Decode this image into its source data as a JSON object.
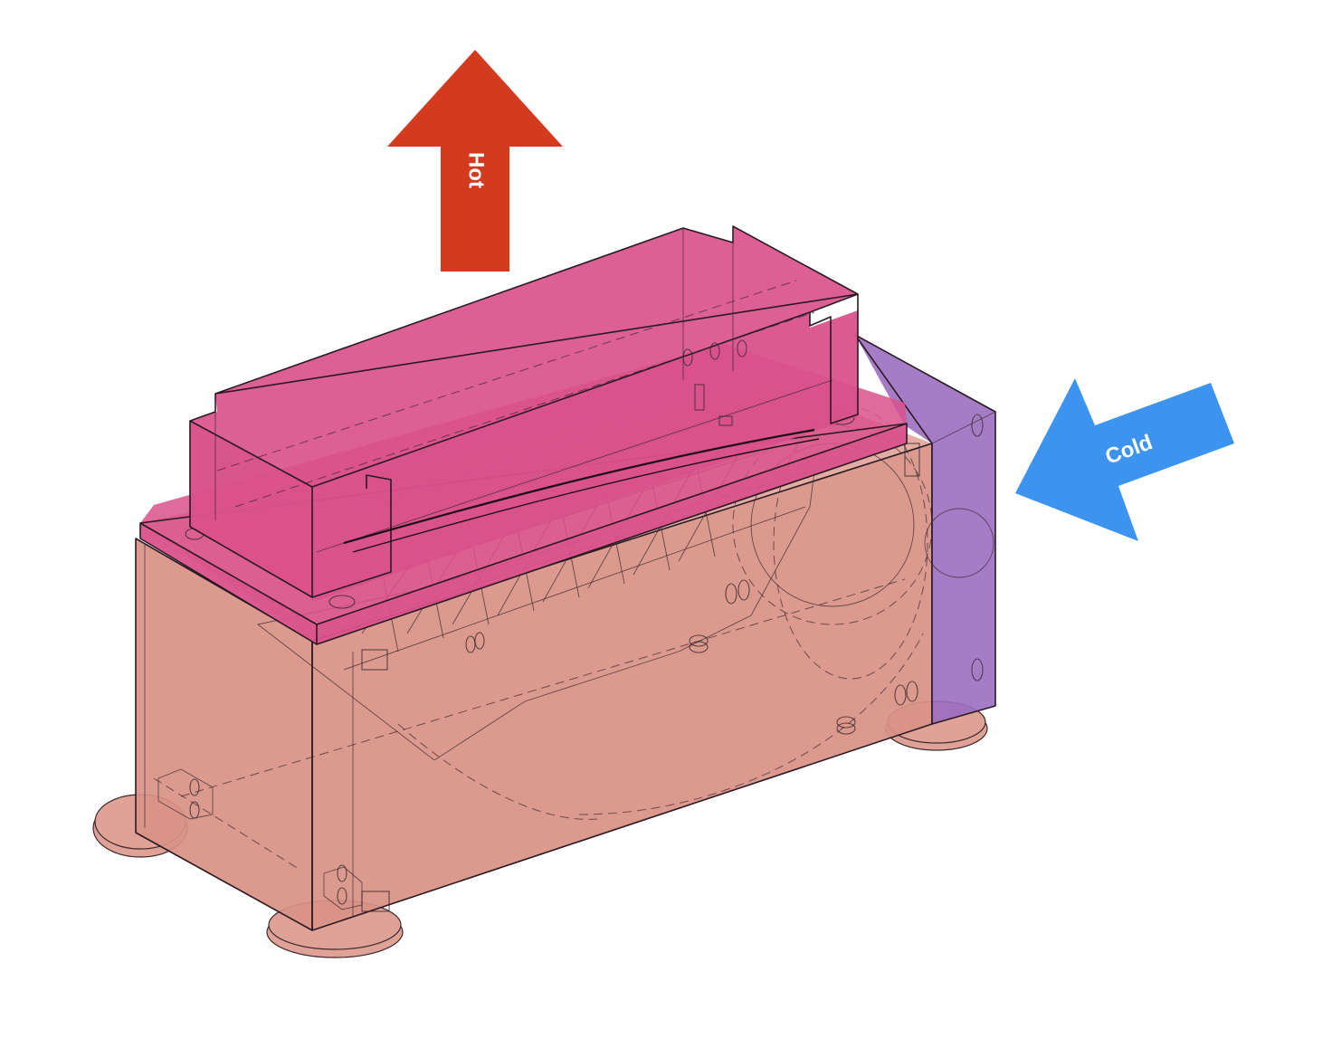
{
  "labels": {
    "hot": "Hot",
    "cold": "Cold"
  },
  "colors": {
    "hot_arrow": "#d33a1e",
    "cold_arrow": "#3d93f0",
    "base_body": "#d99185",
    "top_cover": "#d9518c",
    "fan_panel": "#9b6ec0",
    "feet": "#e0a296"
  }
}
